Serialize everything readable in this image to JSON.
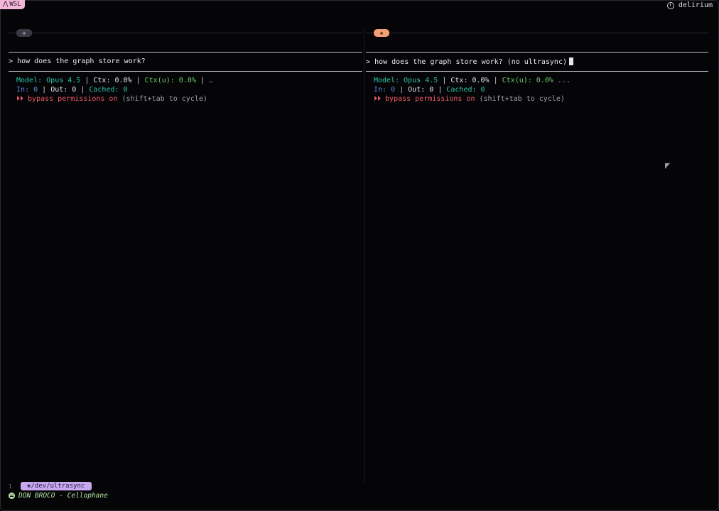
{
  "topbar": {
    "wsl_label": "WSL",
    "hostname": "delirium",
    "clock_icon": "clock-icon"
  },
  "panes": [
    {
      "chip_icon": "diamond-icon",
      "prompt_symbol": ">",
      "prompt_text": "how does the graph store work?",
      "status": {
        "model_label": "Model: ",
        "model_value": "Opus 4.5",
        "ctx": "Ctx: 0.0%",
        "ctxu": "Ctx(u): 0.0%",
        "tail": "…",
        "in_label": "In: ",
        "in_value": "0",
        "out": "Out: 0",
        "cached": "Cached: 0",
        "bypass_arrows": "⏵⏵",
        "bypass": "bypass permissions on",
        "bypass_hint": "(shift+tab to cycle)"
      }
    },
    {
      "chip_icon": "diamond-icon",
      "prompt_symbol": ">",
      "prompt_text": "how does the graph store work? (no ultrasync)",
      "status": {
        "model_label": "Model: ",
        "model_value": "Opus 4.5",
        "ctx": "Ctx: 0.0%",
        "ctxu": "Ctx(u): 0.0%",
        "tail": "...",
        "in_label": "In: ",
        "in_value": "0",
        "out": "Out: 0",
        "cached": "Cached: 0",
        "bypass_arrows": "⏵⏵",
        "bypass": "bypass permissions on",
        "bypass_hint": "(shift+tab to cycle)"
      }
    }
  ],
  "bottom": {
    "pane_index": "1",
    "path": "◈/dev/ultrasync",
    "music_icon": "spotify-icon",
    "now_playing": "DON BROCO - Cellophane"
  },
  "colors": {
    "accent_pink": "#f4b6d8",
    "accent_orange": "#f0a074",
    "accent_purple": "#c7a8f0",
    "teal": "#2ec4a6",
    "red": "#f05a6a"
  }
}
